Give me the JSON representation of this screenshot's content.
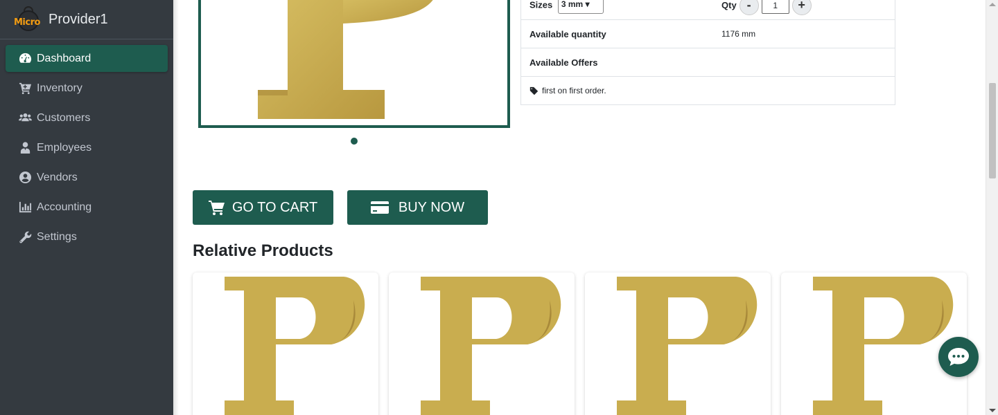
{
  "brand": {
    "logo_text": "Micro",
    "name": "Provider1"
  },
  "sidebar": {
    "items": [
      {
        "label": "Dashboard",
        "icon": "tachometer-icon",
        "active": true
      },
      {
        "label": "Inventory",
        "icon": "cart-plus-icon"
      },
      {
        "label": "Customers",
        "icon": "users-icon"
      },
      {
        "label": "Employees",
        "icon": "user-tie-icon"
      },
      {
        "label": "Vendors",
        "icon": "user-circle-icon"
      },
      {
        "label": "Accounting",
        "icon": "chart-bar-icon"
      },
      {
        "label": "Settings",
        "icon": "wrench-icon"
      }
    ]
  },
  "product": {
    "sizes_label": "Sizes",
    "size_value": "3 mm",
    "qty_label": "Qty",
    "qty_minus": "-",
    "qty_value": "1",
    "qty_plus": "+",
    "available_quantity_label": "Available quantity",
    "available_quantity_value": "1176 mm",
    "available_offers_label": "Available Offers",
    "offer_text": "first on first order."
  },
  "actions": {
    "go_to_cart": "GO TO CART",
    "buy_now": "BUY NOW"
  },
  "related": {
    "title": "Relative Products",
    "count": 4
  },
  "colors": {
    "accent": "#1e5c4f",
    "sidebar_bg": "#343a40",
    "gold": "#c9ad4f"
  }
}
